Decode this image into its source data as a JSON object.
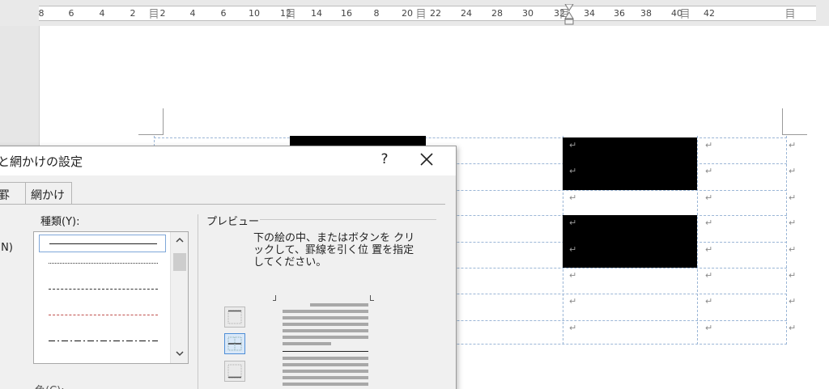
{
  "ruler": {
    "numbers": [
      "8",
      "6",
      "4",
      "2",
      "2",
      "4",
      "6",
      "10",
      "12",
      "14",
      "16",
      "8",
      "20",
      "22",
      "24",
      "28",
      "30",
      "32",
      "34",
      "36",
      "38",
      "40",
      "42"
    ]
  },
  "dialog": {
    "title": "と網かけの設定",
    "help": "?",
    "close": "✕",
    "tabs": [
      "罫線",
      "網かけ"
    ],
    "left_labels": [
      ")(N)",
      ")"
    ],
    "style_label": "種類(Y):",
    "preview_label": "プレビュー",
    "preview_hint": "下の絵の中、またはボタンを クリックして、罫線を引く位 置を指定してください。",
    "bottom_label": "色(C):",
    "line_styles": [
      "solid",
      "dotted",
      "dashed",
      "dashed-red",
      "dash-dot"
    ]
  },
  "table": {
    "paragraph_mark": "↵"
  },
  "colors": {
    "accent_blue": "#4f8ed6",
    "table_gridline": "#9bb6d6",
    "shaded_cell": "#000000"
  }
}
